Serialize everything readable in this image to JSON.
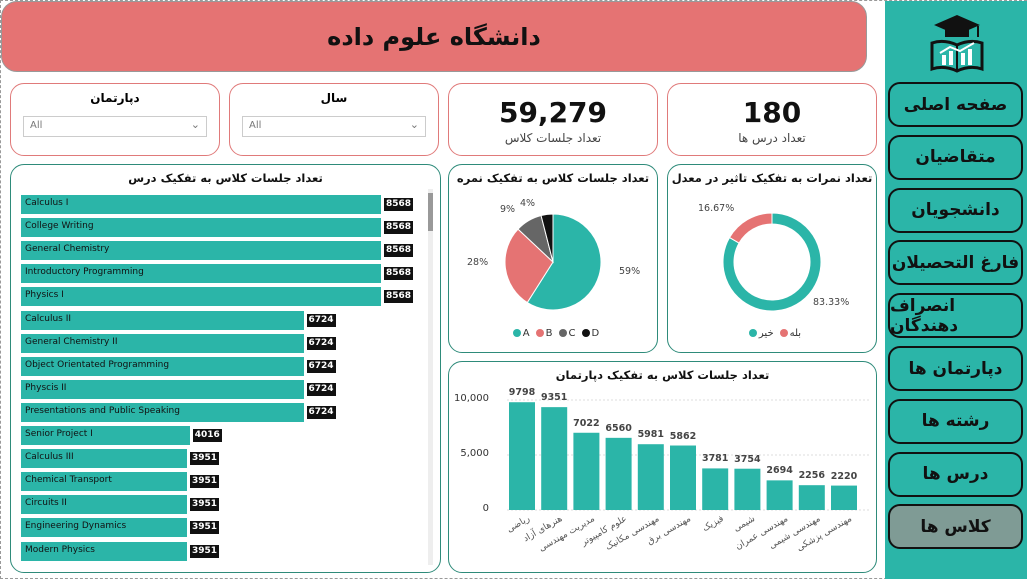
{
  "header": {
    "title": "دانشگاه علوم داده"
  },
  "nav": [
    {
      "label": "صفحه اصلی"
    },
    {
      "label": "متقاضیان"
    },
    {
      "label": "دانشجویان"
    },
    {
      "label": "فارغ التحصیلان"
    },
    {
      "label": "انصراف دهندگان"
    },
    {
      "label": "دپارتمان ها"
    },
    {
      "label": "رشته ها"
    },
    {
      "label": "درس ها"
    },
    {
      "label": "کلاس ها"
    }
  ],
  "slicers": {
    "department": {
      "label": "دپارتمان",
      "value": "All"
    },
    "year": {
      "label": "سال",
      "value": "All"
    }
  },
  "kpis": {
    "sessions": {
      "value": "59,279",
      "label": "تعداد جلسات کلاس"
    },
    "courses": {
      "value": "180",
      "label": "تعداد درس ها"
    }
  },
  "course_chart_title": "تعداد جلسات کلاس به تفکیک درس",
  "grade_chart": {
    "title": "تعداد جلسات کلاس به تفکیک نمره",
    "labels": [
      "59%",
      "28%",
      "9%",
      "4%"
    ]
  },
  "effect_chart": {
    "title": "تعداد نمرات به تفکیک تاثیر در معدل",
    "labels": [
      "83.33%",
      "16.67%"
    ],
    "legend": [
      "بله",
      "خیر"
    ]
  },
  "dept_chart_title": "تعداد جلسات کلاس به تفکیک دپارتمان",
  "chart_data": [
    {
      "type": "bar",
      "orientation": "horizontal",
      "title": "تعداد جلسات کلاس به تفکیک درس",
      "categories": [
        "Calculus I",
        "College Writing",
        "General Chemistry",
        "Introductory Programming",
        "Physics I",
        "Calculus II",
        "General Chemistry II",
        "Object Orientated Programming",
        "Physcis II",
        "Presentations and Public Speaking",
        "Senior Project I",
        "Calculus III",
        "Chemical Transport",
        "Circuits II",
        "Engineering Dynamics",
        "Modern Physics"
      ],
      "values": [
        8568,
        8568,
        8568,
        8568,
        8568,
        6724,
        6724,
        6724,
        6724,
        6724,
        4016,
        3951,
        3951,
        3951,
        3951,
        3951
      ],
      "color": "#2bb5a8"
    },
    {
      "type": "pie",
      "title": "تعداد جلسات کلاس به تفکیک نمره",
      "categories": [
        "A",
        "B",
        "C",
        "D"
      ],
      "values": [
        59,
        28,
        9,
        4
      ],
      "colors": [
        "#2bb5a8",
        "#e57373",
        "#666666",
        "#111111"
      ]
    },
    {
      "type": "pie",
      "donut": true,
      "title": "تعداد نمرات به تفکیک تاثیر در معدل",
      "categories": [
        "بله",
        "خیر"
      ],
      "values": [
        83.33,
        16.67
      ],
      "colors": [
        "#2bb5a8",
        "#e57373"
      ]
    },
    {
      "type": "bar",
      "title": "تعداد جلسات کلاس به تفکیک دپارتمان",
      "categories": [
        "ریاضی",
        "هنرهای آزاد",
        "مدیریت مهندسی",
        "علوم کامپیوتر",
        "مهندسی مکانیک",
        "مهندسی برق",
        "فیزیک",
        "شیمی",
        "مهندسی عمران",
        "مهندسی شیمی",
        "مهندسی پزشکی"
      ],
      "values": [
        9798,
        9351,
        7022,
        6560,
        5981,
        5862,
        3781,
        3754,
        2694,
        2256,
        2220
      ],
      "yticks": [
        "0",
        "5,000",
        "10,000"
      ],
      "ylim": [
        0,
        10000
      ],
      "color": "#2bb5a8"
    }
  ]
}
